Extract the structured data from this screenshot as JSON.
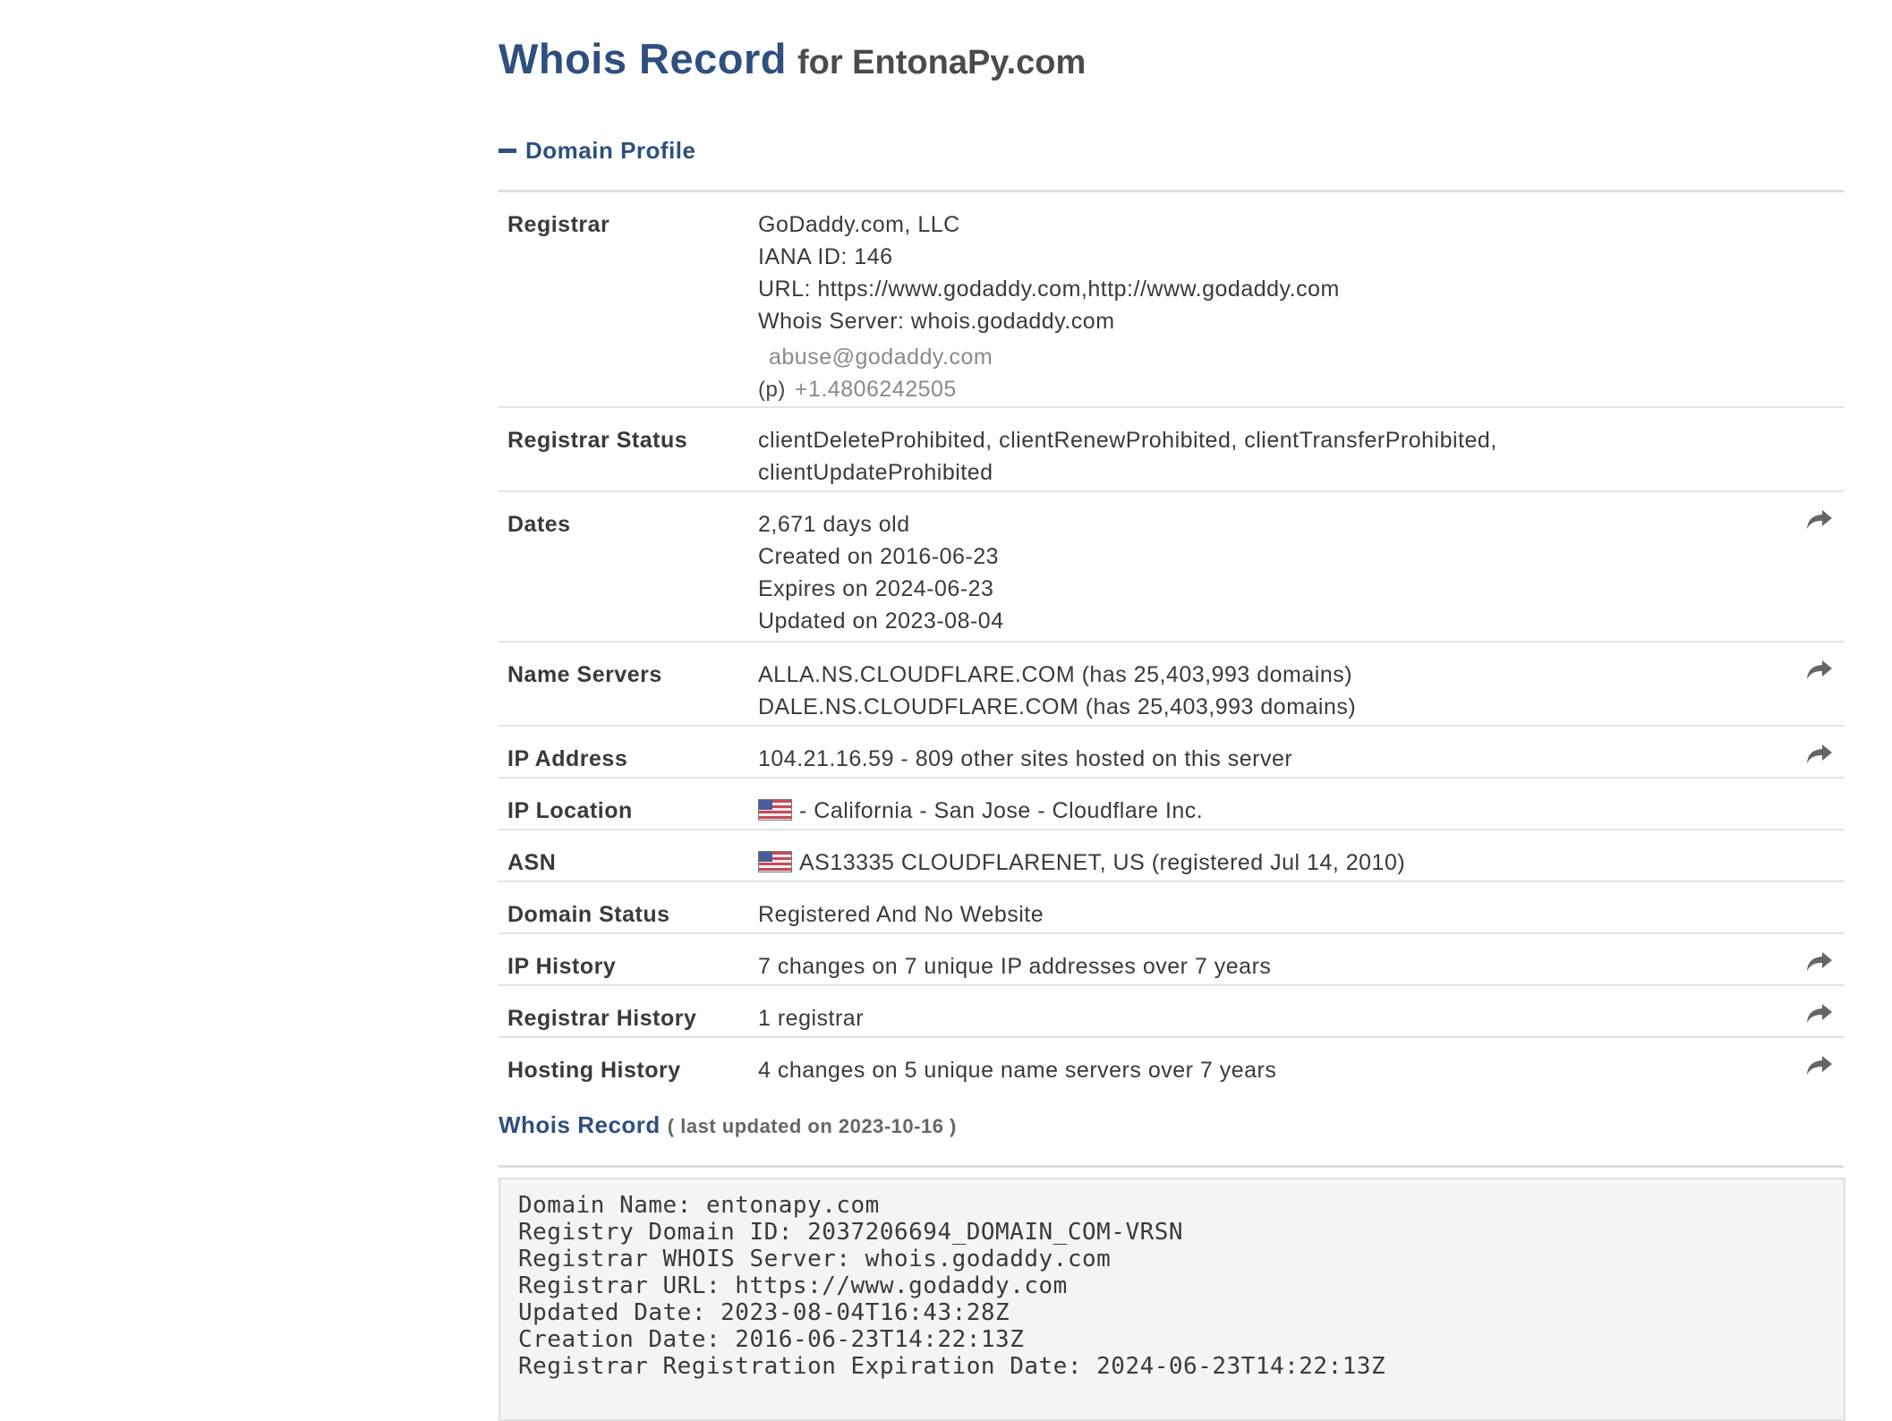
{
  "page": {
    "title_main": "Whois Record",
    "title_suffix": "for EntonaPy.com"
  },
  "profile": {
    "heading": "Domain Profile",
    "rows": {
      "registrar": {
        "label": "Registrar",
        "name": "GoDaddy.com, LLC",
        "iana": "IANA ID: 146",
        "url": "URL: https://www.godaddy.com,http://www.godaddy.com",
        "whois_server": "Whois Server: whois.godaddy.com",
        "email": "abuse@godaddy.com",
        "phone_prefix": "(p)",
        "phone": "+1.4806242505"
      },
      "registrar_status": {
        "label": "Registrar Status",
        "line1": "clientDeleteProhibited, clientRenewProhibited, clientTransferProhibited,",
        "line2": "clientUpdateProhibited"
      },
      "dates": {
        "label": "Dates",
        "age": "2,671 days old",
        "created": "Created on 2016-06-23",
        "expires": "Expires on 2024-06-23",
        "updated": "Updated on 2023-08-04"
      },
      "name_servers": {
        "label": "Name Servers",
        "ns1": "ALLA.NS.CLOUDFLARE.COM (has 25,403,993 domains)",
        "ns2": "DALE.NS.CLOUDFLARE.COM (has 25,403,993 domains)"
      },
      "ip_address": {
        "label": "IP Address",
        "value": "104.21.16.59 - 809 other sites hosted on this server"
      },
      "ip_location": {
        "label": "IP Location",
        "value": "- California - San Jose - Cloudflare Inc."
      },
      "asn": {
        "label": "ASN",
        "value": "AS13335 CLOUDFLARENET, US (registered Jul 14, 2010)"
      },
      "domain_status": {
        "label": "Domain Status",
        "value": "Registered And No Website"
      },
      "ip_history": {
        "label": "IP History",
        "value": "7 changes on 7 unique IP addresses over 7 years"
      },
      "registrar_history": {
        "label": "Registrar History",
        "value": "1 registrar"
      },
      "hosting_history": {
        "label": "Hosting History",
        "value": "4 changes on 5 unique name servers over 7 years"
      }
    }
  },
  "record": {
    "heading": "Whois Record",
    "updated": "( last updated on 2023-10-16 )",
    "lines": [
      "Domain Name: entonapy.com",
      "Registry Domain ID: 2037206694_DOMAIN_COM-VRSN",
      "Registrar WHOIS Server: whois.godaddy.com",
      "Registrar URL: https://www.godaddy.com",
      "Updated Date: 2023-08-04T16:43:28Z",
      "Creation Date: 2016-06-23T14:22:13Z",
      "Registrar Registration Expiration Date: 2024-06-23T14:22:13Z"
    ]
  },
  "icons": {
    "share": "share-arrow-icon",
    "flag": "us-flag-icon",
    "collapse": "minus-icon"
  },
  "colors": {
    "accent": "#2f4f7f",
    "text": "#3a3a3a",
    "rule": "#dddddd",
    "code_bg": "#f4f4f4"
  }
}
